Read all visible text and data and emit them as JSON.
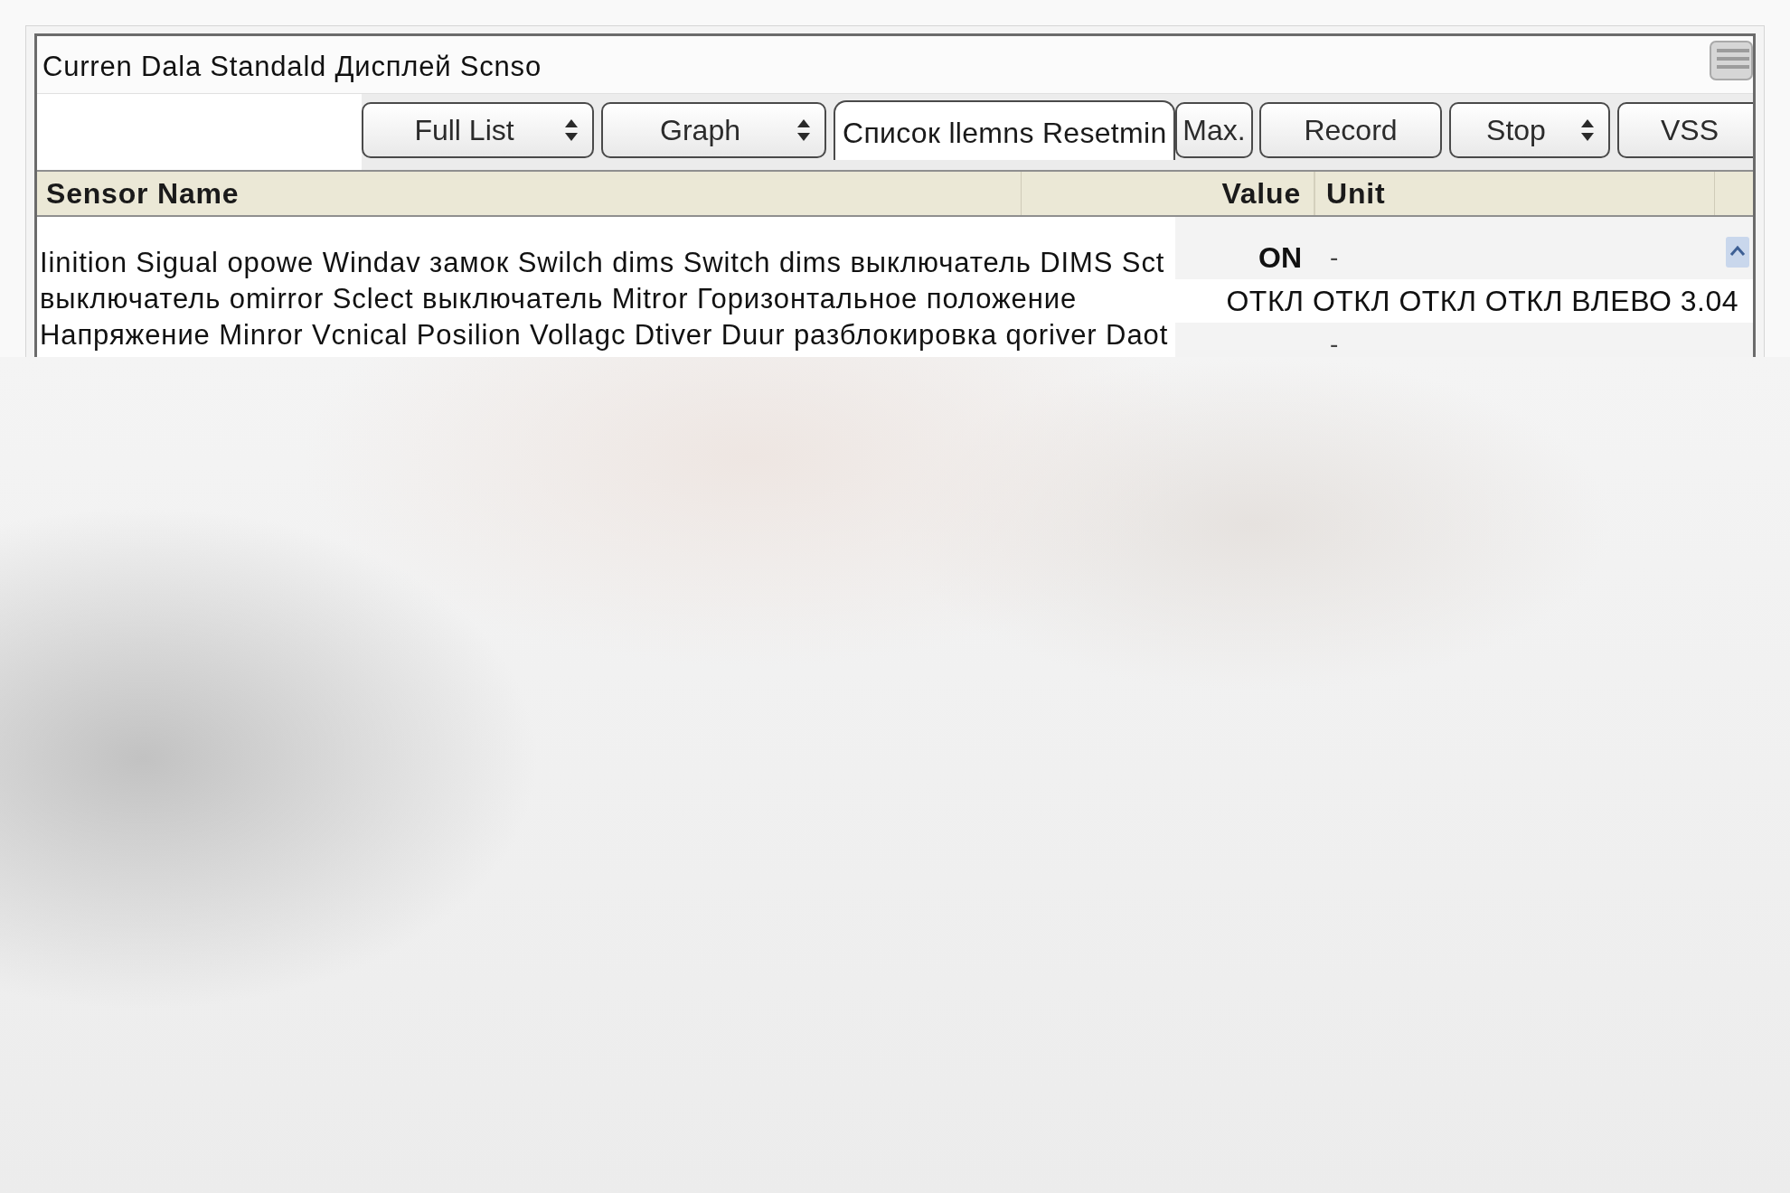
{
  "window": {
    "title": "Curren Dala Standald Дисплей Scnso"
  },
  "toolbar": [
    {
      "kind": "select",
      "label": "Full List"
    },
    {
      "kind": "select",
      "label": "Graph"
    },
    {
      "kind": "tab",
      "label": "Список llemns Resetmin"
    },
    {
      "kind": "button",
      "label": "Max."
    },
    {
      "kind": "button",
      "label": "Record"
    },
    {
      "kind": "select",
      "label": "Stop"
    },
    {
      "kind": "button",
      "label": "VSS"
    }
  ],
  "table": {
    "columns": [
      "Sensor Name",
      "Value",
      "Unit"
    ],
    "sensor_name_lines": [
      "Iinition Sigual opowe Windav замок Swilch dims Switch dims выключатель DIMS Sct",
      "выключатель omirror Sclect выключатель Mitror Горизонтальное положение",
      "Напряжение Minror Vcnical Posilion Vollagc Dtiver Duur разблокировка qoriver Daot"
    ],
    "rows": [
      {
        "kind": "single",
        "value": "ON",
        "unit": "-"
      },
      {
        "kind": "spanning",
        "value": "ОТКЛ ОТКЛ ОТКЛ ОТКЛ ВЛЕВО 3.04"
      },
      {
        "kind": "single",
        "unit": "-"
      }
    ]
  }
}
